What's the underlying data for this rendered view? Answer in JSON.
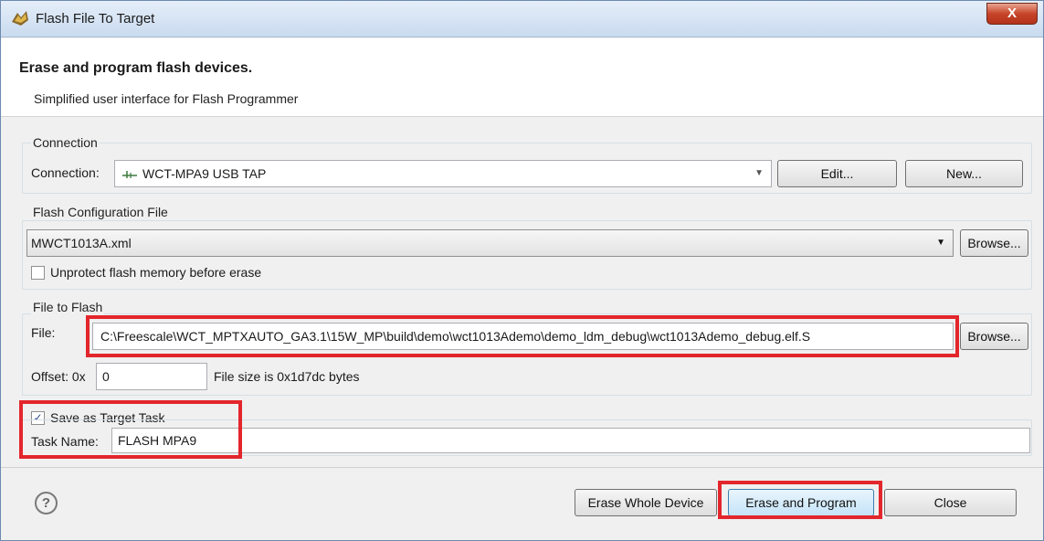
{
  "window": {
    "title": "Flash File To Target",
    "close_glyph": "X"
  },
  "header": {
    "title": "Erase and program flash devices.",
    "subtitle": "Simplified user interface for Flash Programmer"
  },
  "connection": {
    "group_label": "Connection",
    "label": "Connection:",
    "value": "WCT-MPA9 USB TAP",
    "icon": "usb-connector-icon",
    "edit_label": "Edit...",
    "new_label": "New..."
  },
  "flash_config": {
    "group_label": "Flash Configuration File",
    "value": "MWCT1013A.xml",
    "browse_label": "Browse...",
    "unprotect_label": "Unprotect flash memory before erase",
    "unprotect_checked": false
  },
  "file_to_flash": {
    "group_label": "File to Flash",
    "file_label": "File:",
    "file_value": "C:\\Freescale\\WCT_MPTXAUTO_GA3.1\\15W_MP\\build\\demo\\wct1013Ademo\\demo_ldm_debug\\wct1013Ademo_debug.elf.S",
    "browse_label": "Browse...",
    "offset_label": "Offset: 0x",
    "offset_value": "0",
    "file_size_text": "File size is 0x1d7dc bytes"
  },
  "target_task": {
    "save_label": "Save as Target Task",
    "save_checked": true,
    "check_glyph": "✓",
    "task_name_label": "Task Name:",
    "task_name_value": "FLASH MPA9"
  },
  "footer": {
    "help_glyph": "?",
    "erase_whole_label": "Erase Whole Device",
    "erase_program_label": "Erase and Program",
    "close_label": "Close"
  },
  "colors": {
    "highlight": "#e3262c",
    "title_bar": "#c9dbef",
    "close_button": "#c7452a",
    "default_button": "#c4e3f8"
  }
}
